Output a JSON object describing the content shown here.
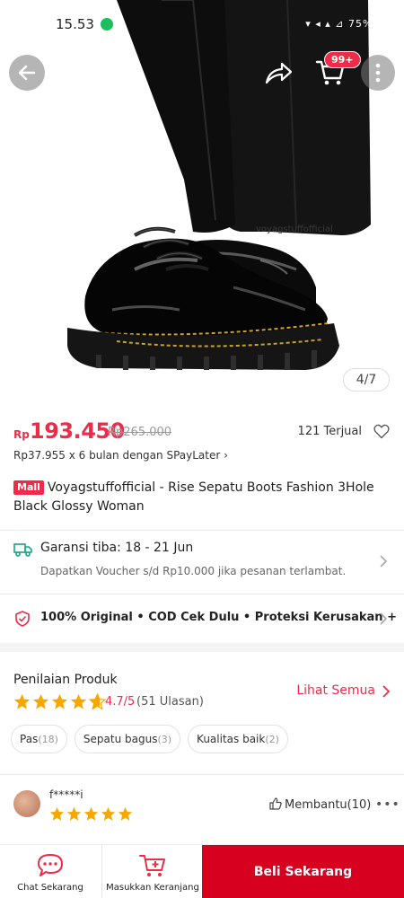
{
  "status_bar": {
    "time": "15.53",
    "icons_text": "▾ ◂ ▴ ⊿ 75%▸"
  },
  "header": {
    "cart_badge": "99+"
  },
  "gallery": {
    "counter": "4/7",
    "current_index": 4,
    "total": 7
  },
  "product": {
    "currency": "Rp",
    "price": "193.450",
    "original_price": "Rp265.000",
    "sold": "121 Terjual",
    "installment": "Rp37.955 x 6 bulan dengan SPayLater ›",
    "mall_tag": "Mall",
    "title": "Voyagstuffofficial - Rise Sepatu Boots Fashion 3Hole Black Glossy Woman"
  },
  "shipping": {
    "title": "Garansi tiba: 18 - 21 Jun",
    "subtitle": "Dapatkan Voucher s/d Rp10.000 jika pesanan terlambat."
  },
  "guarantee": {
    "text": "100% Original  •  COD Cek Dulu  •  Proteksi Kerusakan +"
  },
  "rating": {
    "title": "Penilaian Produk",
    "stars": 4.7,
    "score": "4.7/5",
    "count": "(51 Ulasan)",
    "see_all": "Lihat Semua",
    "chips": [
      {
        "label": "Pas",
        "count": "(18)"
      },
      {
        "label": "Sepatu bagus",
        "count": "(3)"
      },
      {
        "label": "Kualitas baik",
        "count": "(2)"
      }
    ]
  },
  "review": {
    "reviewer": "f*****i",
    "stars": 5,
    "helpful": "Membantu(10)",
    "more": "•••"
  },
  "bottom_bar": {
    "chat_label": "Chat Sekarang",
    "cart_label": "Masukkan Keranjang",
    "buy_label": "Beli Sekarang"
  },
  "colors": {
    "accent": "#ee2c4a",
    "buy_button": "#d7001f",
    "star": "#f6a700",
    "status_dot": "#19c05d"
  }
}
